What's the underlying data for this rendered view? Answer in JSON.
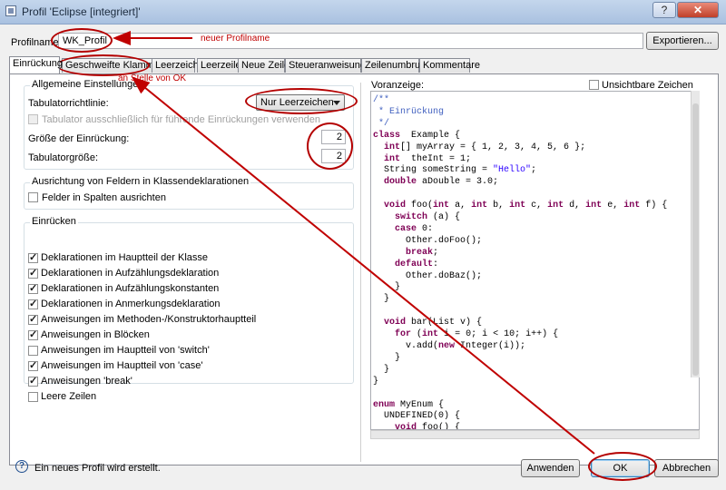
{
  "window": {
    "title": "Profil 'Eclipse [integriert]'",
    "help_glyph": "?",
    "close_glyph": "✕"
  },
  "profile": {
    "name_label": "Profilname:",
    "name_value": "WK_Profil",
    "export_label": "Exportieren..."
  },
  "tabs": [
    {
      "label": "Einrückung",
      "active": true
    },
    {
      "label": "Geschweifte Klammern"
    },
    {
      "label": "Leerzeichen"
    },
    {
      "label": "Leerzeilen"
    },
    {
      "label": "Neue Zeilen"
    },
    {
      "label": "Steueranweisungen"
    },
    {
      "label": "Zeilenumbruch"
    },
    {
      "label": "Kommentare"
    }
  ],
  "general": {
    "title": "Allgemeine Einstellungen",
    "tab_policy_label": "Tabulatorrichtlinie:",
    "tab_policy_value": "Nur Leerzeichen",
    "tab_only_leading_label": "Tabulator ausschließlich für führende Einrückungen verwenden",
    "indent_size_label": "Größe der Einrückung:",
    "indent_size_value": "2",
    "tab_size_label": "Tabulatorgröße:",
    "tab_size_value": "2"
  },
  "alignment": {
    "title": "Ausrichtung von Feldern in Klassendeklarationen",
    "columns_label": "Felder in Spalten ausrichten"
  },
  "indent": {
    "title": "Einrücken",
    "items": [
      {
        "label": "Deklarationen im Hauptteil der Klasse",
        "checked": true
      },
      {
        "label": "Deklarationen in Aufzählungsdeklaration",
        "checked": true
      },
      {
        "label": "Deklarationen in Aufzählungskonstanten",
        "checked": true
      },
      {
        "label": "Deklarationen in Anmerkungsdeklaration",
        "checked": true
      },
      {
        "label": "Anweisungen im Methoden-/Konstruktorhauptteil",
        "checked": true
      },
      {
        "label": "Anweisungen in Blöcken",
        "checked": true
      },
      {
        "label": "Anweisungen im Hauptteil von 'switch'",
        "checked": false
      },
      {
        "label": "Anweisungen im Hauptteil von 'case'",
        "checked": true
      },
      {
        "label": "Anweisungen 'break'",
        "checked": true
      },
      {
        "label": "Leere Zeilen",
        "checked": false
      }
    ]
  },
  "preview": {
    "label": "Voranzeige:",
    "invisible_label": "Unsichtbare Zeichen anzeigen",
    "code_lines": [
      [
        [
          "cm",
          "/**"
        ]
      ],
      [
        [
          "cm",
          " * Einrückung"
        ]
      ],
      [
        [
          "cm",
          " */"
        ]
      ],
      [
        [
          "kw",
          "class"
        ],
        [
          "",
          "  Example {"
        ]
      ],
      [
        [
          "",
          "  "
        ],
        [
          "kw",
          "int"
        ],
        [
          "",
          "[] myArray = { 1, 2, 3, 4, 5, 6 };"
        ]
      ],
      [
        [
          "",
          "  "
        ],
        [
          "kw",
          "int"
        ],
        [
          "",
          "  theInt = 1;"
        ]
      ],
      [
        [
          "",
          "  String someString = "
        ],
        [
          "str",
          "\"Hello\""
        ],
        [
          "",
          ";"
        ]
      ],
      [
        [
          "",
          "  "
        ],
        [
          "kw",
          "double"
        ],
        [
          "",
          " aDouble = 3.0;"
        ]
      ],
      [
        [
          "",
          ""
        ]
      ],
      [
        [
          "",
          "  "
        ],
        [
          "kw",
          "void"
        ],
        [
          "",
          " foo("
        ],
        [
          "kw",
          "int"
        ],
        [
          "",
          " a, "
        ],
        [
          "kw",
          "int"
        ],
        [
          "",
          " b, "
        ],
        [
          "kw",
          "int"
        ],
        [
          "",
          " c, "
        ],
        [
          "kw",
          "int"
        ],
        [
          "",
          " d, "
        ],
        [
          "kw",
          "int"
        ],
        [
          "",
          " e, "
        ],
        [
          "kw",
          "int"
        ],
        [
          "",
          " f) {"
        ]
      ],
      [
        [
          "",
          "    "
        ],
        [
          "kw",
          "switch"
        ],
        [
          "",
          " (a) {"
        ]
      ],
      [
        [
          "",
          "    "
        ],
        [
          "kw",
          "case"
        ],
        [
          "",
          " 0:"
        ]
      ],
      [
        [
          "",
          "      Other.doFoo();"
        ]
      ],
      [
        [
          "",
          "      "
        ],
        [
          "kw",
          "break"
        ],
        [
          "",
          ";"
        ]
      ],
      [
        [
          "",
          "    "
        ],
        [
          "kw",
          "default"
        ],
        [
          "",
          ":"
        ]
      ],
      [
        [
          "",
          "      Other.doBaz();"
        ]
      ],
      [
        [
          "",
          "    }"
        ]
      ],
      [
        [
          "",
          "  }"
        ]
      ],
      [
        [
          "",
          ""
        ]
      ],
      [
        [
          "",
          "  "
        ],
        [
          "kw",
          "void"
        ],
        [
          "",
          " bar(List v) {"
        ]
      ],
      [
        [
          "",
          "    "
        ],
        [
          "kw",
          "for"
        ],
        [
          "",
          " ("
        ],
        [
          "kw",
          "int"
        ],
        [
          "",
          " i = 0; i < 10; i++) {"
        ]
      ],
      [
        [
          "",
          "      v.add("
        ],
        [
          "kw",
          "new"
        ],
        [
          "",
          " Integer(i));"
        ]
      ],
      [
        [
          "",
          "    }"
        ]
      ],
      [
        [
          "",
          "  }"
        ]
      ],
      [
        [
          "",
          "}"
        ]
      ],
      [
        [
          "",
          ""
        ]
      ],
      [
        [
          "kw",
          "enum"
        ],
        [
          "",
          " MyEnum {"
        ]
      ],
      [
        [
          "",
          "  UNDEFINED(0) {"
        ]
      ],
      [
        [
          "",
          "    "
        ],
        [
          "kw",
          "void"
        ],
        [
          "",
          " foo() {"
        ]
      ],
      [
        [
          "",
          "    }"
        ]
      ]
    ]
  },
  "footer": {
    "status": "Ein neues Profil wird erstellt.",
    "apply_label": "Anwenden",
    "ok_label": "OK",
    "cancel_label": "Abbrechen"
  },
  "annotations": {
    "new_profile_name": "neuer Profilname",
    "instead_of_ok": "an Stelle von OK",
    "color": "#c00000"
  }
}
